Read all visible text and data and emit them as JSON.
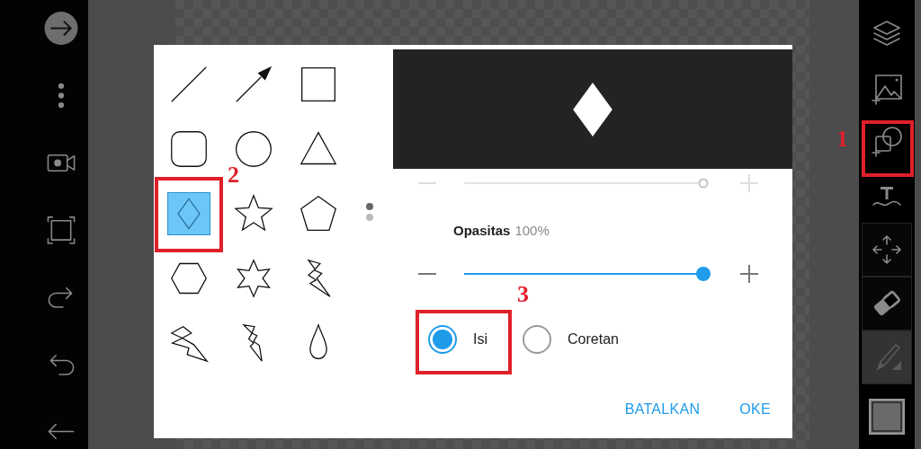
{
  "left_toolbar": {
    "items": [
      {
        "kind": "forward"
      },
      {
        "kind": "more"
      },
      {
        "kind": "camera"
      },
      {
        "kind": "frame"
      },
      {
        "kind": "redo"
      },
      {
        "kind": "undo"
      },
      {
        "kind": "back"
      }
    ]
  },
  "right_toolbar": {
    "tools": [
      {
        "kind": "layers",
        "selected": false
      },
      {
        "kind": "image",
        "selected": false
      },
      {
        "kind": "shape",
        "selected": false
      },
      {
        "kind": "text",
        "selected": false
      },
      {
        "kind": "move",
        "selected": false
      },
      {
        "kind": "eraser",
        "selected": false
      },
      {
        "kind": "brush",
        "selected": true
      },
      {
        "kind": "swatch",
        "selected": false
      }
    ]
  },
  "shape_dialog": {
    "shapes": [
      {
        "kind": "line",
        "selected": false
      },
      {
        "kind": "arrow",
        "selected": false
      },
      {
        "kind": "square",
        "selected": false
      },
      {
        "kind": "rounded",
        "selected": false
      },
      {
        "kind": "circle",
        "selected": false
      },
      {
        "kind": "triangle",
        "selected": false
      },
      {
        "kind": "diamond",
        "selected": true
      },
      {
        "kind": "star",
        "selected": false
      },
      {
        "kind": "pentagon",
        "selected": false
      },
      {
        "kind": "hexagon",
        "selected": false
      },
      {
        "kind": "star6",
        "selected": false
      },
      {
        "kind": "bolt1",
        "selected": false
      },
      {
        "kind": "bolt2",
        "selected": false
      },
      {
        "kind": "bolt3",
        "selected": false
      },
      {
        "kind": "drop",
        "selected": false
      }
    ],
    "pages": [
      {
        "selected": true
      },
      {
        "selected": false
      }
    ],
    "size_slider": {
      "level": 1.0,
      "disabled": true
    },
    "opacity": {
      "label": "Opasitas",
      "value": "100%",
      "level": 1.0,
      "disabled": false
    },
    "fill_modes": [
      {
        "label": "Isi",
        "selected": true
      },
      {
        "label": "Coretan",
        "selected": false
      }
    ],
    "buttons": [
      "BATALKAN",
      "OKE"
    ]
  },
  "annotations": [
    {
      "kind": "tool",
      "label": "1"
    },
    {
      "kind": "shape",
      "label": "2"
    },
    {
      "kind": "fill",
      "label": "3"
    }
  ]
}
